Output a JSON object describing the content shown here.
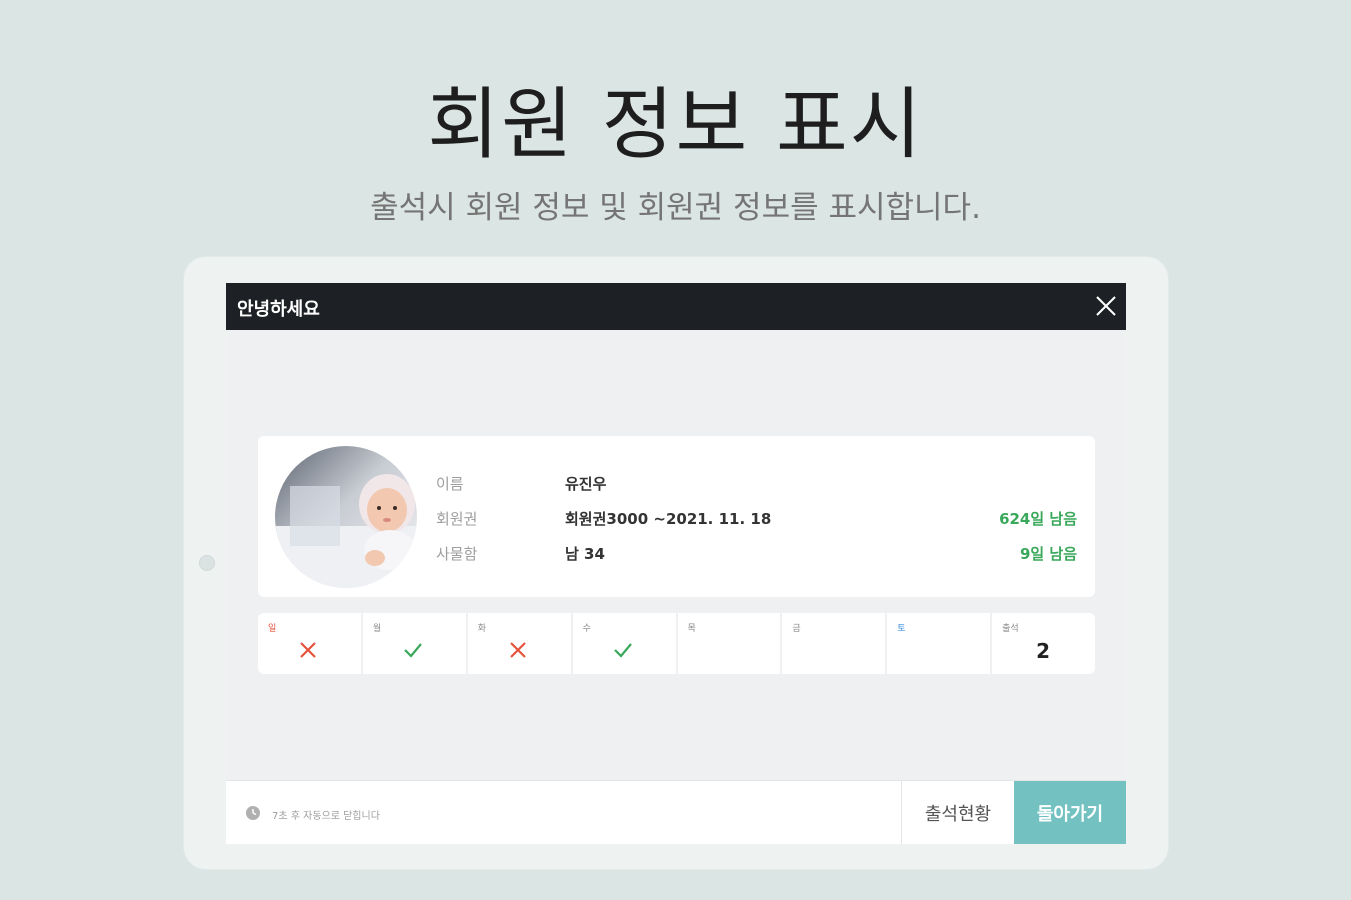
{
  "hero": {
    "title": "회원 정보 표시",
    "subtitle": "출석시 회원 정보 및 회원권 정보를 표시합니다."
  },
  "dialog": {
    "title": "안녕하세요",
    "close_icon": "close-icon"
  },
  "member": {
    "name_label": "이름",
    "name_value": "유진우",
    "membership_label": "회원권",
    "membership_value": "회원권3000 ~2021. 11. 18",
    "membership_remaining": "624일 남음",
    "locker_label": "사물함",
    "locker_value": "남 34",
    "locker_remaining": "9일 남음"
  },
  "week": {
    "days": [
      {
        "label": "일",
        "status": "absent",
        "label_color": "#e5533d"
      },
      {
        "label": "월",
        "status": "present",
        "label_color": "#8a8a8a"
      },
      {
        "label": "화",
        "status": "absent",
        "label_color": "#8a8a8a"
      },
      {
        "label": "수",
        "status": "present",
        "label_color": "#8a8a8a"
      },
      {
        "label": "목",
        "status": "none",
        "label_color": "#8a8a8a"
      },
      {
        "label": "금",
        "status": "none",
        "label_color": "#8a8a8a"
      },
      {
        "label": "토",
        "status": "none",
        "label_color": "#3c8fe0"
      }
    ],
    "attendance_label": "출석",
    "attendance_count": "2"
  },
  "footer": {
    "timer_text": "7초 후 자동으로 닫힙니다",
    "status_button": "출석현황",
    "back_button": "돌아가기"
  },
  "colors": {
    "background": "#dbe5e4",
    "topbar": "#1d2125",
    "accent": "#73c2c1",
    "remaining_green": "#39a85a",
    "check_green": "#39a85a",
    "cross_red": "#e5533d"
  }
}
